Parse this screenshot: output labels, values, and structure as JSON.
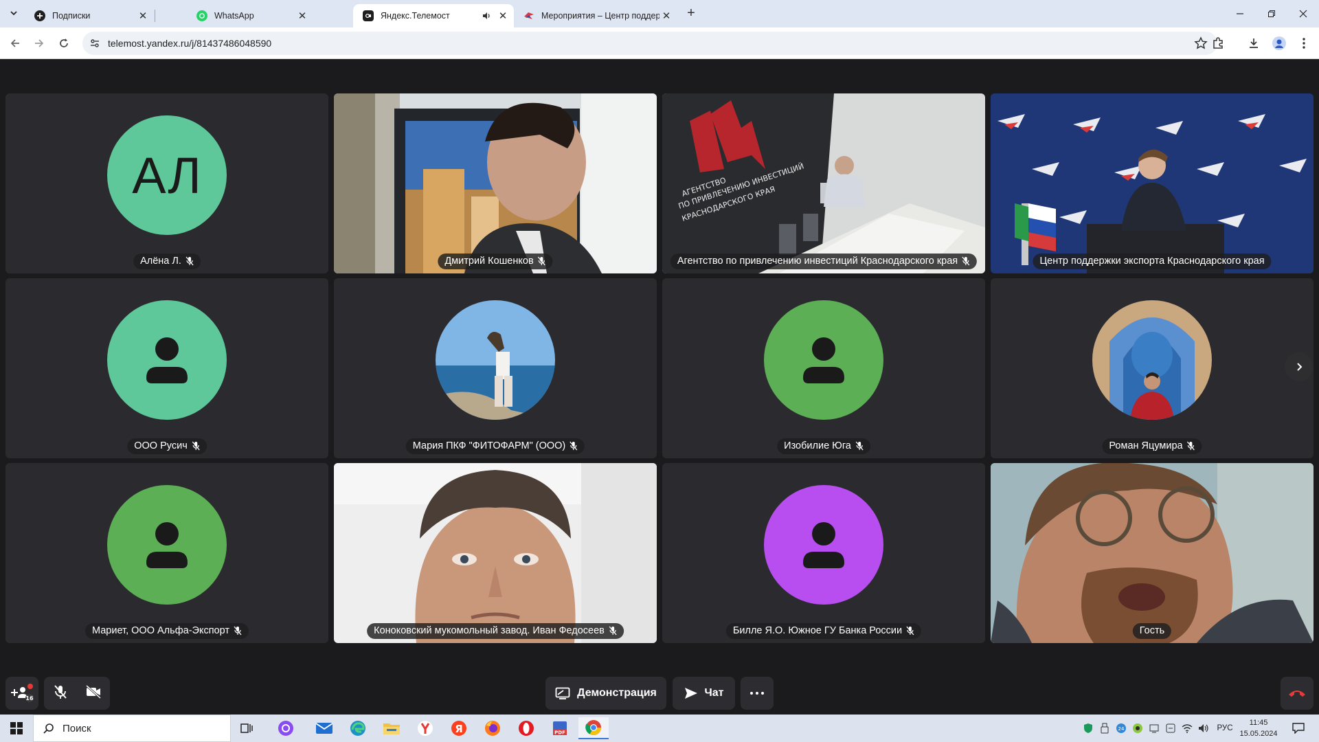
{
  "browser": {
    "tabs": [
      {
        "title": "Подписки",
        "icon": "subscriptions-icon"
      },
      {
        "title": "WhatsApp",
        "icon": "whatsapp-icon"
      },
      {
        "title": "Яндекс.Телемост",
        "icon": "telemost-icon",
        "active": true,
        "audio": true
      },
      {
        "title": "Мероприятия – Центр поддер",
        "icon": "site-favicon-icon"
      }
    ],
    "url": "telemost.yandex.ru/j/81437486048590"
  },
  "participants": [
    {
      "name": "Алёна Л.",
      "type": "initials",
      "initials": "АЛ",
      "color": "#5fc89a",
      "muted": true
    },
    {
      "name": "Дмитрий Кошенков",
      "type": "video",
      "muted": true
    },
    {
      "name": "Агентство по привлечению инвестиций Краснодарского края",
      "type": "video",
      "muted": true
    },
    {
      "name": "Центр поддержки экспорта Краснодарского края",
      "type": "video",
      "muted": false
    },
    {
      "name": "ООО Русич",
      "type": "icon",
      "color": "#5fc89a",
      "muted": true
    },
    {
      "name": "Мария ПКФ \"ФИТОФАРМ\" (ООО)",
      "type": "photo",
      "muted": true
    },
    {
      "name": "Изобилие Юга",
      "type": "icon",
      "color": "#5caf55",
      "muted": true
    },
    {
      "name": "Роман Яцумира",
      "type": "photo",
      "muted": true
    },
    {
      "name": "Мариет, ООО Альфа-Экспорт",
      "type": "icon",
      "color": "#5caf55",
      "muted": true
    },
    {
      "name": "Коноковский мукомольный завод. Иван Федосеев",
      "type": "video",
      "muted": true
    },
    {
      "name": "Билле Я.О. Южное ГУ Банка России",
      "type": "icon",
      "color": "#b94ef0",
      "muted": true
    },
    {
      "name": "Гость",
      "type": "video",
      "muted": false,
      "speaking": true
    }
  ],
  "controls": {
    "participants_badge": "16",
    "demo_label": "Демонстрация",
    "chat_label": "Чат"
  },
  "taskbar": {
    "search_placeholder": "Поиск",
    "lang": "РУС",
    "time": "11:45",
    "date": "15.05.2024"
  },
  "colors": {
    "stage_bg": "#1b1b1d",
    "tile_bg": "#2b2b2f",
    "speaking_border": "#f5c83b",
    "hangup": "#d93b3b"
  }
}
